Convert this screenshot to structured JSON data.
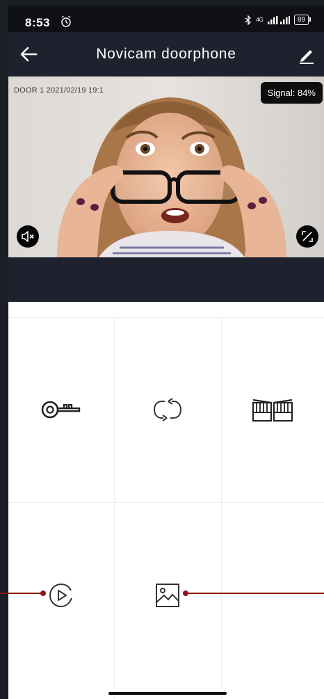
{
  "status_bar": {
    "time": "8:53",
    "network": "4G",
    "battery": "89"
  },
  "header": {
    "title": "Novicam doorphone"
  },
  "video": {
    "stamp": "DOOR 1 2021/02/19 19:1",
    "signal": "Signal: 84%"
  },
  "controls": {
    "unlock_icon": "key-icon",
    "switch_icon": "cycle-arrows-icon",
    "gate_icon": "gate-icon",
    "playback_icon": "play-circle-icon",
    "gallery_icon": "image-icon"
  },
  "colors": {
    "header_bg": "#1d222e",
    "pointer": "#8b1a14",
    "icon": "#222222"
  }
}
